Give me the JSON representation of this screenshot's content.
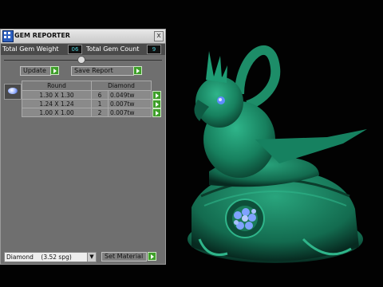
{
  "panel": {
    "title": "GEM REPORTER",
    "close": "x",
    "total_weight_label": "Total Gem Weight",
    "total_weight_value": "06",
    "total_count_label": "Total Gem Count",
    "total_count_value": "9",
    "update_label": "Update",
    "save_report_label": "Save Report"
  },
  "table": {
    "headers": [
      "Round",
      "Diamond"
    ],
    "rows": [
      {
        "size": "1.30 X 1.30",
        "count": "6",
        "weight": "0.049tw"
      },
      {
        "size": "1.24 X 1.24",
        "count": "1",
        "weight": "0.007tw"
      },
      {
        "size": "1.00 X 1.00",
        "count": "2",
        "weight": "0.007tw"
      }
    ]
  },
  "material": {
    "selected": "Diamond    (3.52 spg)",
    "set_label": "Set Material"
  },
  "colors": {
    "model": "#1f8f6a",
    "accent_green": "#3f9f2a",
    "panel_bg": "#6f6f6f",
    "value_text": "#4fd0d8"
  },
  "icons": [
    "app-grid-icon",
    "close-icon",
    "play-icon",
    "gem-icon",
    "dropdown-arrow-icon"
  ]
}
